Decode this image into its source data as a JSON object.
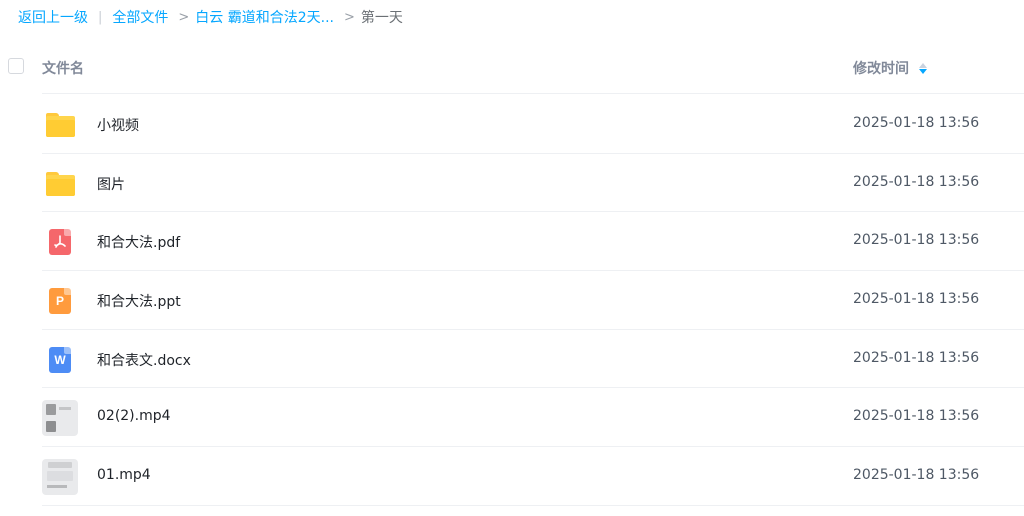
{
  "breadcrumb": {
    "back": "返回上一级",
    "all_files": "全部文件",
    "folder": "白云 霸道和合法2天...",
    "current": "第一天",
    "sep_bar": "|",
    "sep": ">"
  },
  "header": {
    "name_col": "文件名",
    "time_col": "修改时间"
  },
  "files": [
    {
      "name": "小视频",
      "time": "2025-01-18 13:56",
      "type": "folder"
    },
    {
      "name": "图片",
      "time": "2025-01-18 13:56",
      "type": "folder"
    },
    {
      "name": "和合大法.pdf",
      "time": "2025-01-18 13:56",
      "type": "pdf"
    },
    {
      "name": "和合大法.ppt",
      "time": "2025-01-18 13:56",
      "type": "ppt"
    },
    {
      "name": "和合表文.docx",
      "time": "2025-01-18 13:56",
      "type": "word"
    },
    {
      "name": "02(2).mp4",
      "time": "2025-01-18 13:56",
      "type": "video"
    },
    {
      "name": "01.mp4",
      "time": "2025-01-18 13:56",
      "type": "video"
    }
  ],
  "colors": {
    "accent": "#06a7ff",
    "folder": "#ffcc33",
    "pdf": "#f5676b",
    "ppt": "#ff9b3d",
    "word": "#4d8cf5"
  },
  "sort": {
    "column": "修改时间",
    "direction": "descending"
  }
}
